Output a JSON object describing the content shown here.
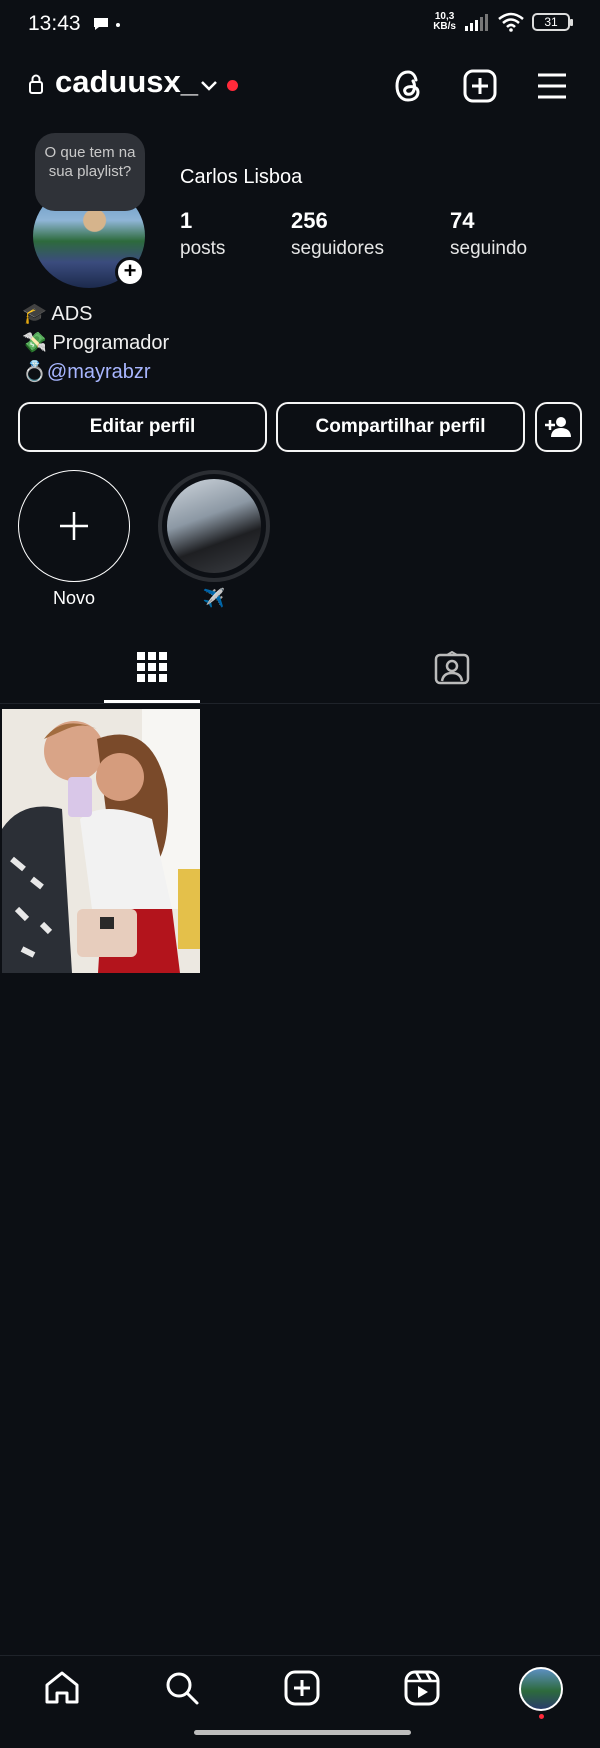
{
  "status_bar": {
    "time": "13:43",
    "speed_value": "10,3",
    "speed_unit": "KB/s",
    "battery": "31"
  },
  "header": {
    "username": "caduusx_",
    "icons": [
      "lock-icon",
      "chevron-down-icon",
      "threads-icon",
      "create-post-icon",
      "menu-icon"
    ]
  },
  "profile": {
    "note": "O que tem na sua playlist?",
    "full_name": "Carlos Lisboa",
    "stats": [
      {
        "value": "1",
        "label": "posts"
      },
      {
        "value": "256",
        "label": "seguidores"
      },
      {
        "value": "74",
        "label": "seguindo"
      }
    ],
    "bio": [
      {
        "emoji": "🎓",
        "text": "ADS"
      },
      {
        "emoji": "💸",
        "text": "Programador"
      },
      {
        "emoji": "💍",
        "text": "@mayrabzr"
      }
    ]
  },
  "actions": {
    "edit_profile": "Editar perfil",
    "share_profile": "Compartilhar perfil"
  },
  "highlights": [
    {
      "label": "Novo"
    },
    {
      "label": "✈️"
    }
  ],
  "tabs": [
    "grid-tab",
    "tagged-tab"
  ],
  "colors": {
    "background": "#0c0f14",
    "accent_red": "#ff2a3a",
    "mention": "#a8b6ff"
  }
}
